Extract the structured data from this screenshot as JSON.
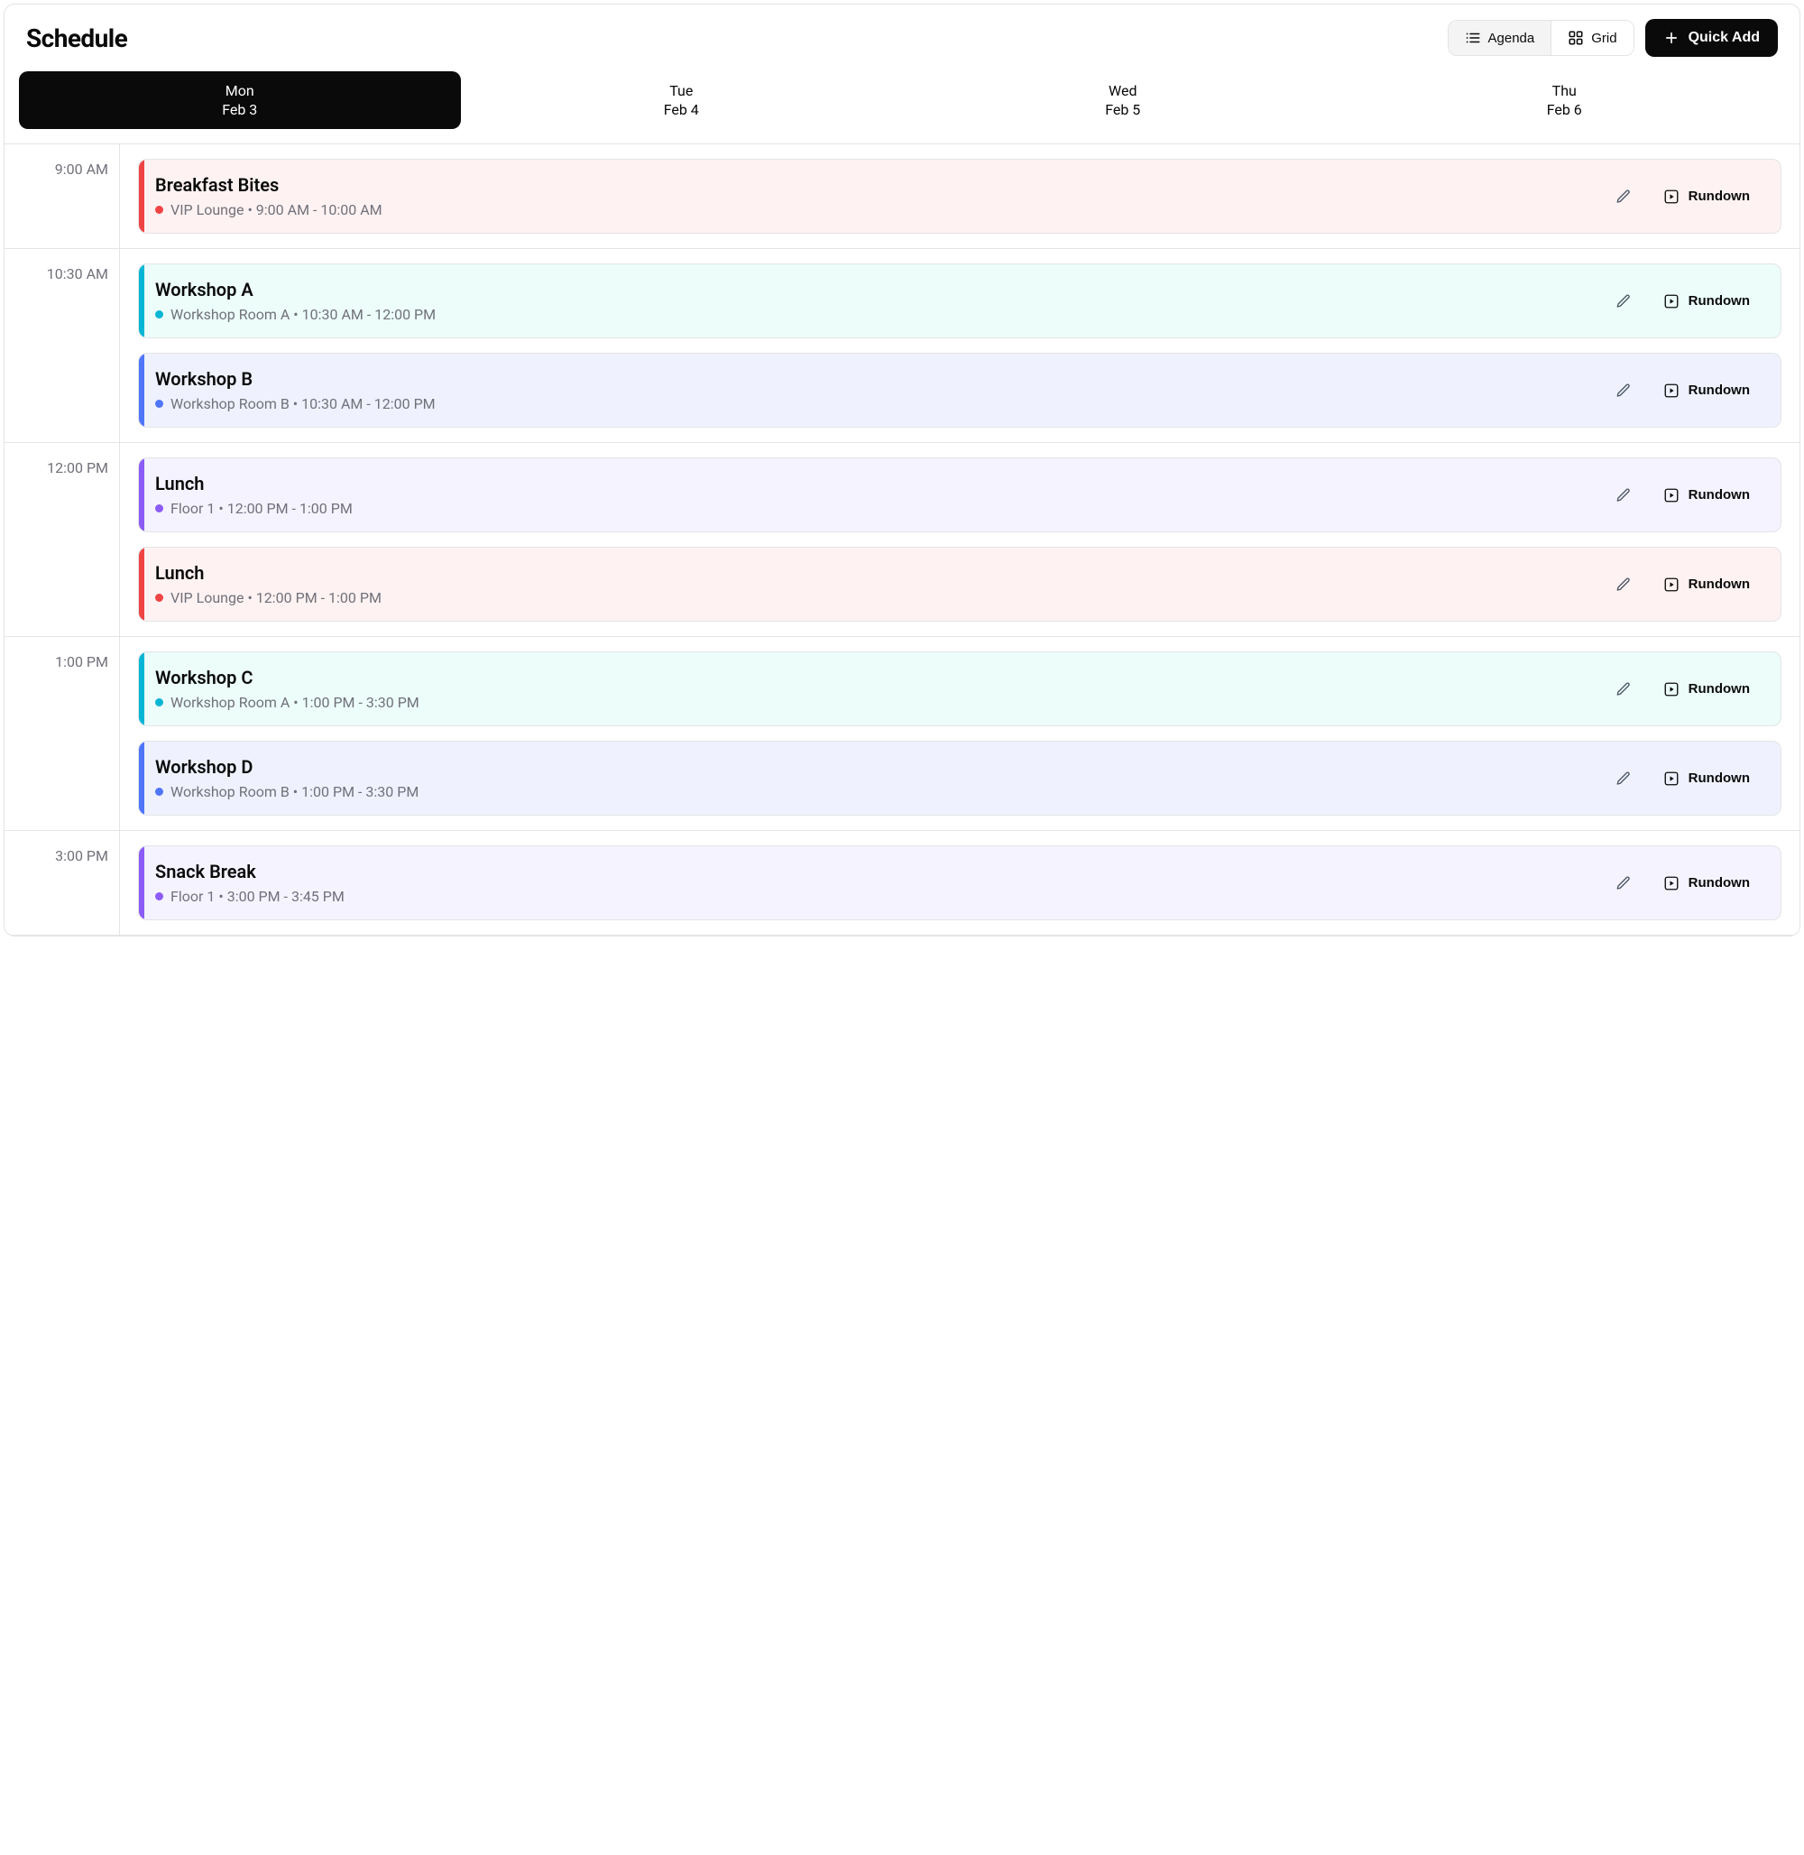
{
  "header": {
    "title": "Schedule",
    "agenda_label": "Agenda",
    "grid_label": "Grid",
    "quick_add_label": "Quick Add"
  },
  "rundown_label": "Rundown",
  "colors": {
    "red": "#ef4444",
    "cyan": "#06b6d4",
    "blue": "#4f75f9",
    "violet": "#8b5cf6"
  },
  "days": [
    {
      "name": "Mon",
      "date": "Feb 3",
      "active": true
    },
    {
      "name": "Tue",
      "date": "Feb 4",
      "active": false
    },
    {
      "name": "Wed",
      "date": "Feb 5",
      "active": false
    },
    {
      "name": "Thu",
      "date": "Feb 6",
      "active": false
    }
  ],
  "slots": [
    {
      "time": "9:00 AM",
      "events": [
        {
          "title": "Breakfast Bites",
          "location": "VIP Lounge",
          "timespan": "9:00 AM - 10:00 AM",
          "color": "red"
        }
      ]
    },
    {
      "time": "10:30 AM",
      "events": [
        {
          "title": "Workshop A",
          "location": "Workshop Room A",
          "timespan": "10:30 AM - 12:00 PM",
          "color": "cyan"
        },
        {
          "title": "Workshop B",
          "location": "Workshop Room B",
          "timespan": "10:30 AM - 12:00 PM",
          "color": "blue"
        }
      ]
    },
    {
      "time": "12:00 PM",
      "events": [
        {
          "title": "Lunch",
          "location": "Floor 1",
          "timespan": "12:00 PM - 1:00 PM",
          "color": "violet"
        },
        {
          "title": "Lunch",
          "location": "VIP Lounge",
          "timespan": "12:00 PM - 1:00 PM",
          "color": "red"
        }
      ]
    },
    {
      "time": "1:00 PM",
      "events": [
        {
          "title": "Workshop C",
          "location": "Workshop Room A",
          "timespan": "1:00 PM - 3:30 PM",
          "color": "cyan"
        },
        {
          "title": "Workshop D",
          "location": "Workshop Room B",
          "timespan": "1:00 PM - 3:30 PM",
          "color": "blue"
        }
      ]
    },
    {
      "time": "3:00 PM",
      "events": [
        {
          "title": "Snack Break",
          "location": "Floor 1",
          "timespan": "3:00 PM - 3:45 PM",
          "color": "violet"
        }
      ]
    }
  ]
}
